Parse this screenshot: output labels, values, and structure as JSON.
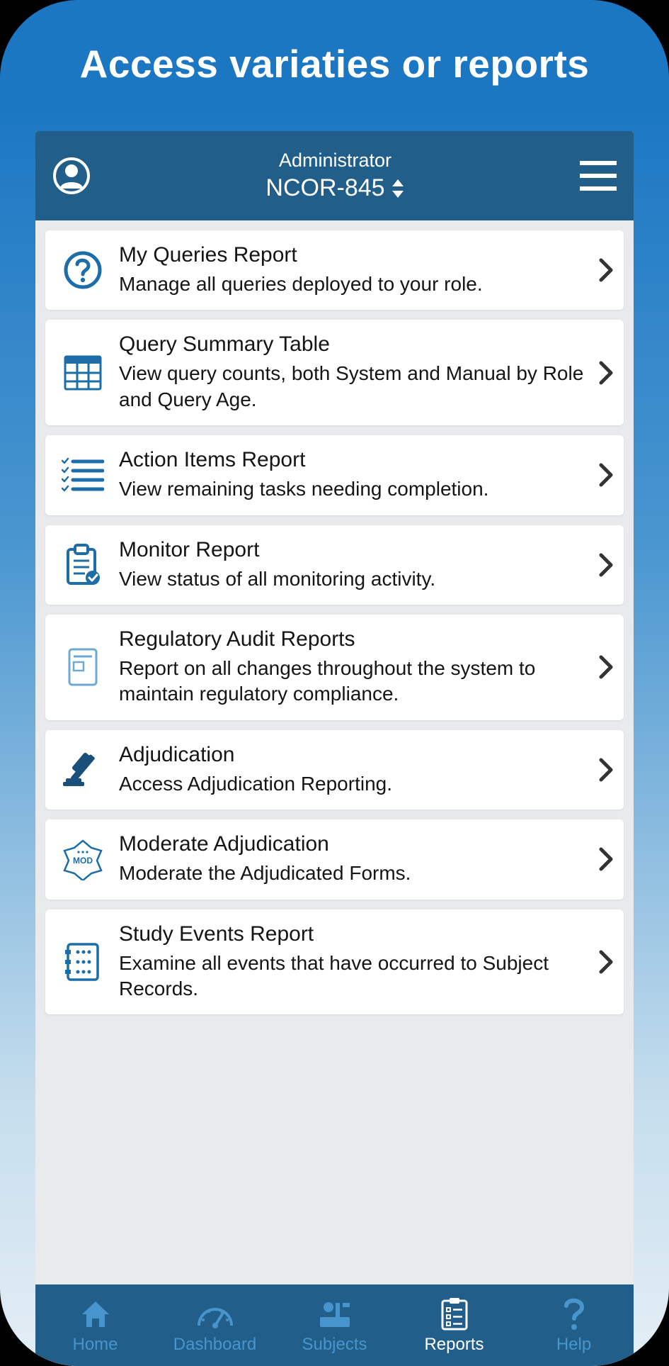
{
  "banner": {
    "title": "Access variaties or reports"
  },
  "header": {
    "role": "Administrator",
    "study": "NCOR-845"
  },
  "reports": [
    {
      "icon": "question-circle",
      "title": "My Queries Report",
      "desc": "Manage all queries deployed to your role."
    },
    {
      "icon": "table-grid",
      "title": "Query Summary Table",
      "desc": "View query counts, both System and Manual by Role and Query Age."
    },
    {
      "icon": "checklist",
      "title": "Action Items Report",
      "desc": "View remaining tasks needing completion."
    },
    {
      "icon": "clipboard-check",
      "title": "Monitor Report",
      "desc": "View status of all monitoring activity."
    },
    {
      "icon": "document",
      "title": "Regulatory Audit Reports",
      "desc": "Report on all changes throughout the system to maintain regulatory compliance."
    },
    {
      "icon": "gavel",
      "title": "Adjudication",
      "desc": "Access Adjudication Reporting."
    },
    {
      "icon": "mod-badge",
      "title": "Moderate Adjudication",
      "desc": "Moderate the Adjudicated Forms."
    },
    {
      "icon": "events",
      "title": "Study Events Report",
      "desc": "Examine all events that have occurred to Subject Records."
    }
  ],
  "nav": {
    "items": [
      {
        "label": "Home",
        "icon": "home",
        "active": false
      },
      {
        "label": "Dashboard",
        "icon": "gauge",
        "active": false
      },
      {
        "label": "Subjects",
        "icon": "subjects",
        "active": false
      },
      {
        "label": "Reports",
        "icon": "clipboard-list",
        "active": true
      },
      {
        "label": "Help",
        "icon": "question",
        "active": false
      }
    ]
  },
  "colors": {
    "brand": "#215f8a",
    "iconBlue": "#1d6ea8",
    "inactive": "#4894cc"
  }
}
